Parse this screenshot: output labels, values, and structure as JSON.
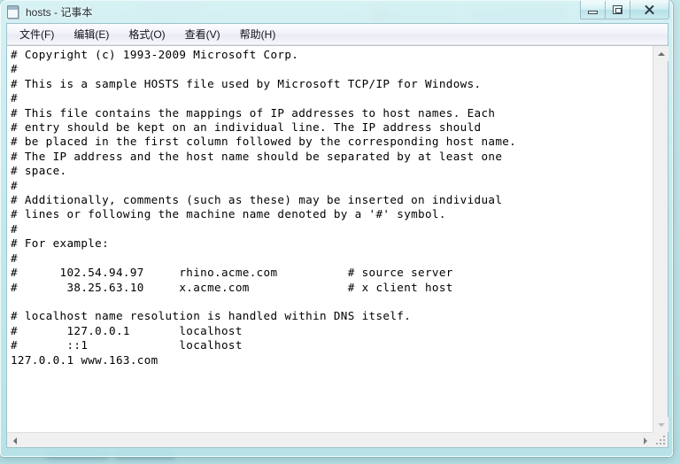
{
  "window": {
    "title": "hosts - 记事本",
    "icon": "notepad-icon"
  },
  "window_controls": {
    "minimize_label": "最小化",
    "maximize_label": "最大化",
    "close_label": "关闭"
  },
  "menu_bar": {
    "items": [
      {
        "label": "文件(F)",
        "name": "menu-file"
      },
      {
        "label": "编辑(E)",
        "name": "menu-edit"
      },
      {
        "label": "格式(O)",
        "name": "menu-format"
      },
      {
        "label": "查看(V)",
        "name": "menu-view"
      },
      {
        "label": "帮助(H)",
        "name": "menu-help"
      }
    ]
  },
  "editor": {
    "font": "monospace",
    "content": "# Copyright (c) 1993-2009 Microsoft Corp.\n#\n# This is a sample HOSTS file used by Microsoft TCP/IP for Windows.\n#\n# This file contains the mappings of IP addresses to host names. Each\n# entry should be kept on an individual line. The IP address should\n# be placed in the first column followed by the corresponding host name.\n# The IP address and the host name should be separated by at least one\n# space.\n#\n# Additionally, comments (such as these) may be inserted on individual\n# lines or following the machine name denoted by a '#' symbol.\n#\n# For example:\n#\n#      102.54.94.97     rhino.acme.com          # source server\n#       38.25.63.10     x.acme.com              # x client host\n\n# localhost name resolution is handled within DNS itself.\n#       127.0.0.1       localhost\n#       ::1             localhost\n127.0.0.1 www.163.com",
    "lines": [
      "# Copyright (c) 1993-2009 Microsoft Corp.",
      "#",
      "# This is a sample HOSTS file used by Microsoft TCP/IP for Windows.",
      "#",
      "# This file contains the mappings of IP addresses to host names. Each",
      "# entry should be kept on an individual line. The IP address should",
      "# be placed in the first column followed by the corresponding host name.",
      "# The IP address and the host name should be separated by at least one",
      "# space.",
      "#",
      "# Additionally, comments (such as these) may be inserted on individual",
      "# lines or following the machine name denoted by a '#' symbol.",
      "#",
      "# For example:",
      "#",
      "#      102.54.94.97     rhino.acme.com          # source server",
      "#       38.25.63.10     x.acme.com              # x client host",
      "",
      "# localhost name resolution is handled within DNS itself.",
      "#       127.0.0.1       localhost",
      "#       ::1             localhost",
      "127.0.0.1 www.163.com"
    ]
  },
  "scrollbars": {
    "vertical": {
      "position": "top",
      "up_arrow": "arrow-up-icon",
      "down_arrow": "arrow-down-icon"
    },
    "horizontal": {
      "position": "left",
      "left_arrow": "arrow-left-icon",
      "right_arrow": "arrow-right-icon"
    }
  },
  "colors": {
    "aero_glass": "#c4e9ed",
    "window_frame": "#9cc4cc",
    "editor_bg": "#ffffff",
    "editor_text": "#000000",
    "menu_bg": "#f2f3fa",
    "scrollbar_track": "#f0f0f0"
  }
}
